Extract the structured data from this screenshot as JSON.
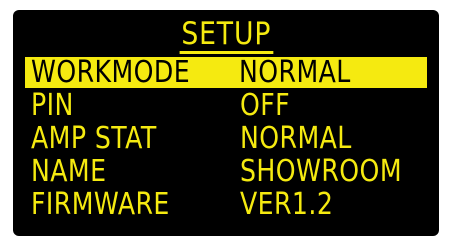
{
  "screen": {
    "title": "SETUP",
    "rows": [
      {
        "label": "WORKMODE",
        "value": "NORMAL",
        "selected": true
      },
      {
        "label": "PIN",
        "value": "OFF"
      },
      {
        "label": "AMP STAT",
        "value": "NORMAL"
      },
      {
        "label": "NAME",
        "value": "SHOWROOM"
      },
      {
        "label": "FIRMWARE",
        "value": "VER1.2"
      }
    ]
  },
  "colors": {
    "background": "#000000",
    "text": "#f5ea10",
    "highlight": "#f5ea10",
    "highlight_text": "#000000"
  }
}
